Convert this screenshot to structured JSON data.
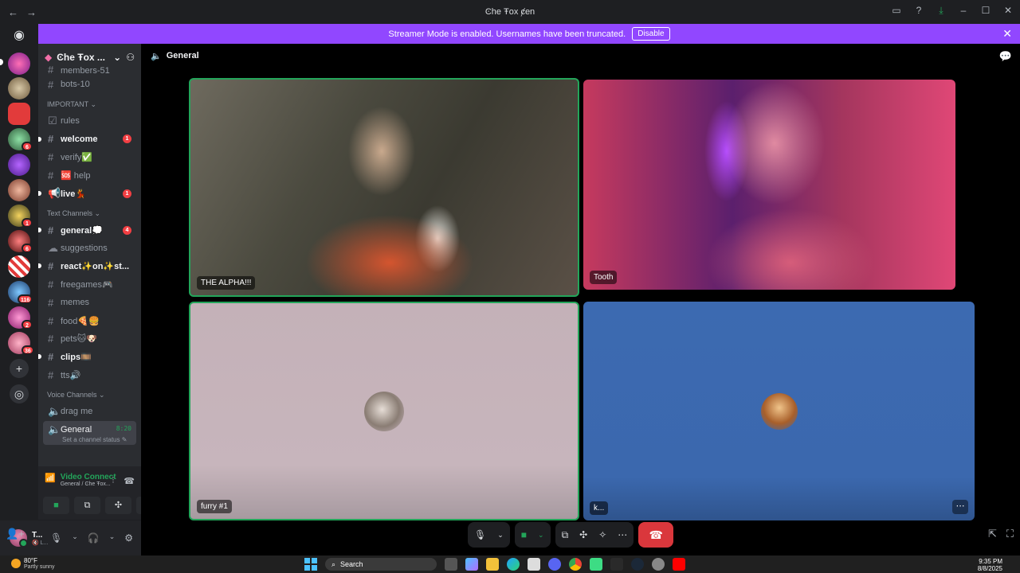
{
  "titlebar": {
    "title": "Ͼhe Ŧox ȼen",
    "back": "←",
    "forward": "→"
  },
  "banner": {
    "text": "Streamer Mode is enabled. Usernames have been truncated.",
    "disable_label": "Disable",
    "close": "✕"
  },
  "server": {
    "name": "Ͼhe Ŧox ..."
  },
  "rail_badges": [
    "6",
    "1",
    "6",
    "116",
    "2",
    "36"
  ],
  "channels": {
    "members": "members-51",
    "bots": "bots-10",
    "cat_important": "IMPORTANT ⌄",
    "rules": "rules",
    "welcome": "welcome",
    "welcome_badge": "1",
    "verify": "verify✅",
    "help": "🆘 help",
    "live": "live💃",
    "live_badge": "1",
    "cat_text": "Text Channels ⌄",
    "general": "general💭",
    "general_badge": "4",
    "suggestions": "suggestions",
    "react": "react✨on✨st...",
    "freegames": "freegames🎮",
    "memes": "memes",
    "food": "food🍕🍔",
    "pets": "pets🐱🐶",
    "clips": "clips🎞️",
    "tts": "tts🔊",
    "cat_voice": "Voice Channels ⌄",
    "dragme": "drag me",
    "voice_general": "General",
    "voice_time": "8:20",
    "voice_status": "Set a channel status ✎"
  },
  "voice_panel": {
    "title": "Video Connect",
    "subtitle": "General / Ͼhe Ŧox..."
  },
  "user": {
    "name": "T...",
    "status": "🔇 L..."
  },
  "main": {
    "channel": "General"
  },
  "tiles": [
    {
      "name": "THE ALPHA!!!"
    },
    {
      "name": "Tooth"
    },
    {
      "name": "furry #1"
    },
    {
      "name": "k..."
    }
  ],
  "taskbar": {
    "temp": "80°F",
    "weather": "Partly sunny",
    "search": "Search",
    "time": "9:35 PM",
    "date": "8/8/2025"
  },
  "colors": {
    "accent": "#9147ff",
    "speaking": "#23a55a",
    "hangup": "#da373c",
    "mention": "#f23f43"
  }
}
